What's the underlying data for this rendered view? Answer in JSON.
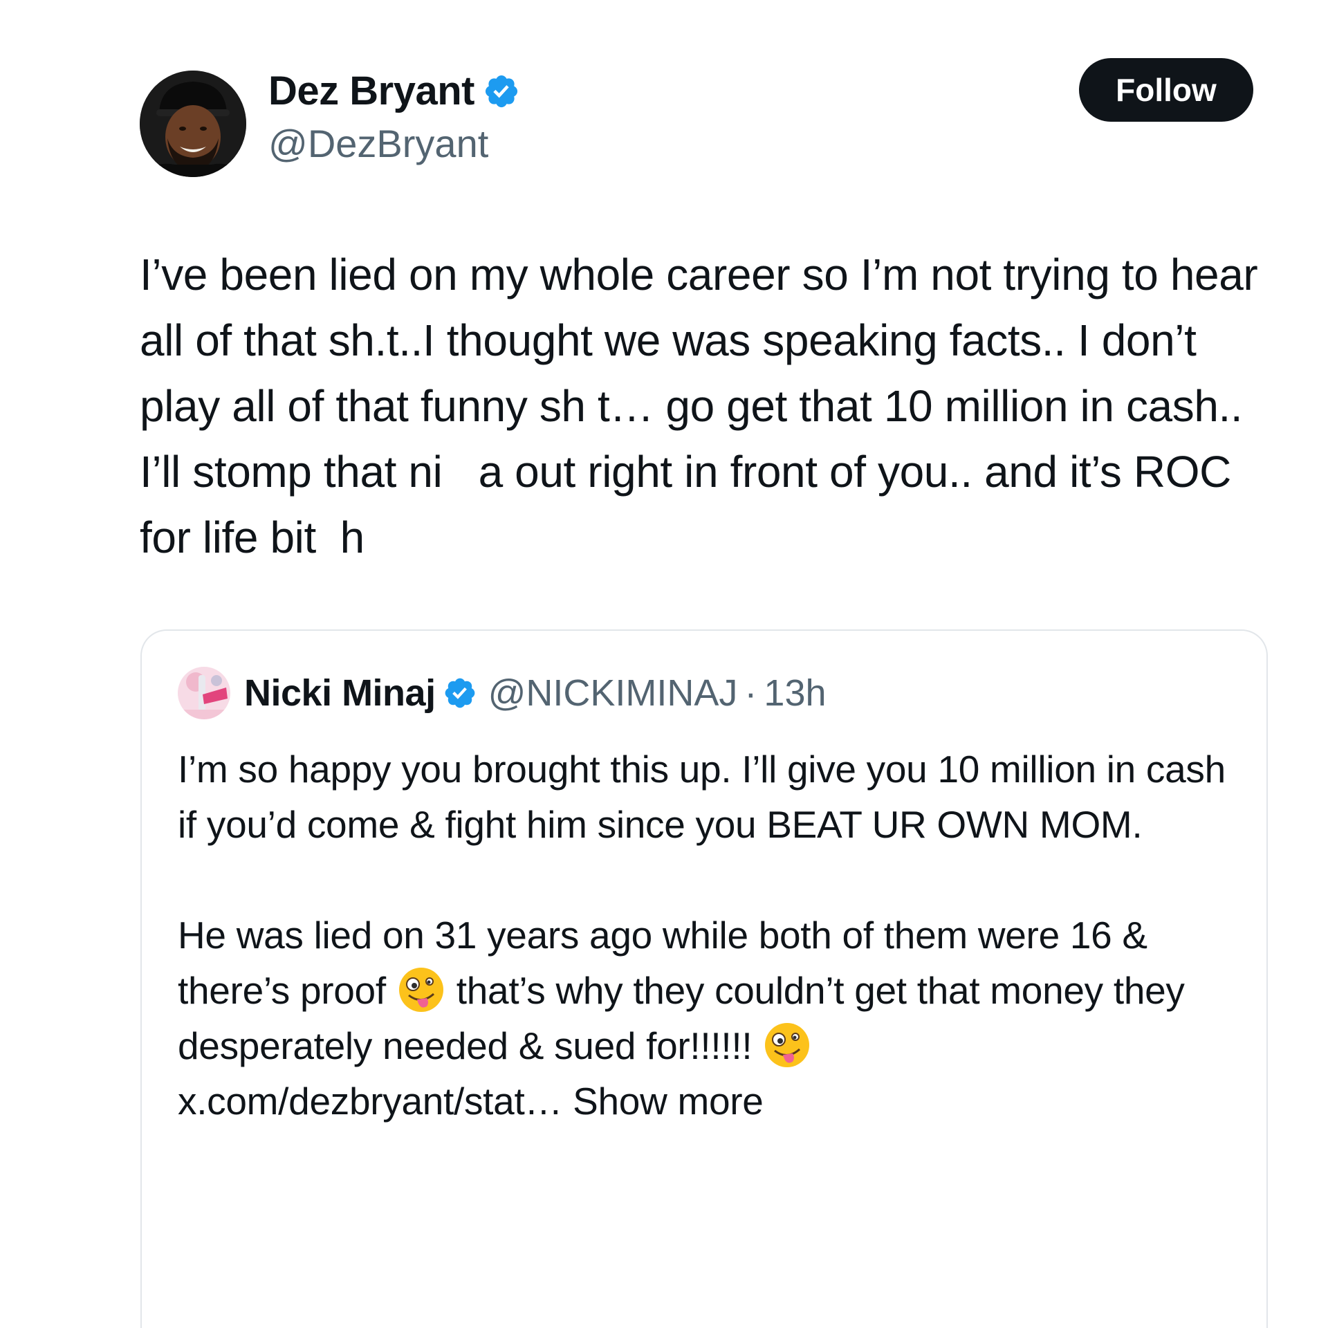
{
  "author": {
    "name": "Dez Bryant",
    "handle": "@DezBryant",
    "verified": true
  },
  "follow_label": "Follow",
  "tweet_text": "I’ve been lied on my whole career so I’m not trying to hear all of that sh.t..I thought we was speaking facts.. I don’t play all of that funny sh t… go get that 10 million in cash.. I’ll stomp that ni   a out right in front of you.. and it’s ROC for life bit  h",
  "quoted_tweet": {
    "name": "Nicki Minaj",
    "handle": "@NICKIMINAJ",
    "separator": "·",
    "time": "13h",
    "verified": true,
    "paragraph1": "I’m so happy you brought this up. I’ll give you 10 million in cash if you’d come & fight him since you BEAT UR OWN MOM.",
    "p2_part1": "He was lied on 31 years ago while both of them were 16 & there’s proof ",
    "p2_part2": " that’s why they couldn’t get that money they desperately needed & sued for!!!!!! ",
    "p2_link": "x.com/dezbryant/stat…",
    "show_more": "Show more",
    "emoji_name": "zany-face-icon"
  },
  "colors": {
    "text": "#0f1419",
    "secondary": "#536471",
    "verified": "#1d9bf0",
    "button_bg": "#0f1419",
    "button_text": "#ffffff",
    "border": "#e2e6ea"
  }
}
